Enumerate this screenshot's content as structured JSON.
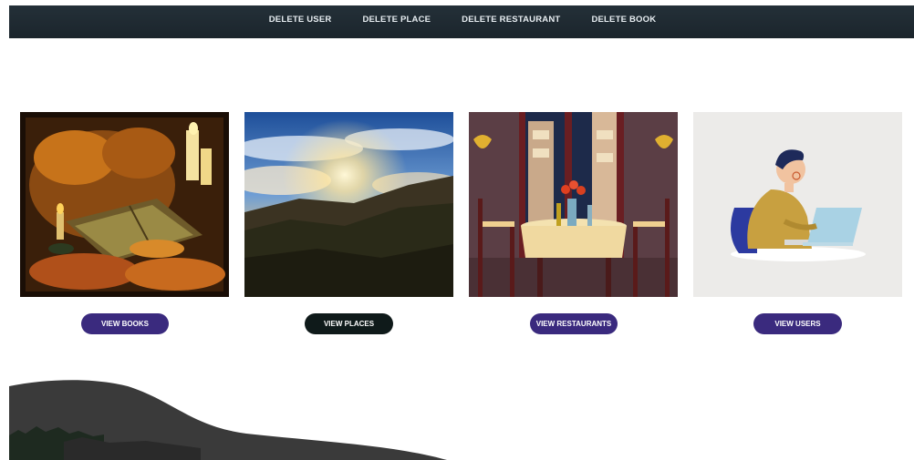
{
  "nav": {
    "items": [
      {
        "label": "DELETE USER"
      },
      {
        "label": "DELETE PLACE"
      },
      {
        "label": "DELETE RESTAURANT"
      },
      {
        "label": "DELETE BOOK"
      }
    ]
  },
  "cards": [
    {
      "image": "autumn-book-still-life",
      "button": "VIEW BOOKS",
      "button_color": "#3a2a7e"
    },
    {
      "image": "sunset-over-forest",
      "button": "VIEW PLACES",
      "button_color": "#0f1a1a"
    },
    {
      "image": "restaurant-dinner-table",
      "button": "VIEW RESTAURANTS",
      "button_color": "#3a2a7e"
    },
    {
      "image": "person-at-laptop",
      "button": "VIEW USERS",
      "button_color": "#3a2a7e"
    }
  ],
  "colors": {
    "navbar": "#1f2a31",
    "accent_purple": "#3a2a7e",
    "dark_button": "#0f1a1a"
  }
}
